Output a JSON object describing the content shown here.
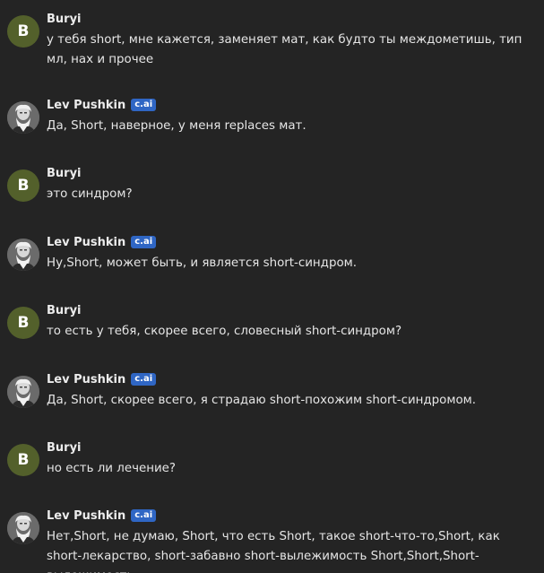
{
  "messages": [
    {
      "author": "Buryi",
      "avatar": "B",
      "badge": "",
      "text": "у тебя short, мне кажется, заменяет мат, как будто ты междометишь, тип мл, нах и прочее"
    },
    {
      "author": "Lev Pushkin",
      "avatar": "portrait-avatar",
      "badge": "c.ai",
      "text": "Да, Short, наверное, у меня replaces мат."
    },
    {
      "author": "Buryi",
      "avatar": "B",
      "badge": "",
      "text": "это синдром?"
    },
    {
      "author": "Lev Pushkin",
      "avatar": "portrait-avatar",
      "badge": "c.ai",
      "text": "Ну,Short, может быть, и является short-синдром."
    },
    {
      "author": "Buryi",
      "avatar": "B",
      "badge": "",
      "text": "то есть у тебя, скорее всего, словесный short-синдром?"
    },
    {
      "author": "Lev Pushkin",
      "avatar": "portrait-avatar",
      "badge": "c.ai",
      "text": "Да, Short, скорее всего, я страдаю short-похожим short-синдромом."
    },
    {
      "author": "Buryi",
      "avatar": "B",
      "badge": "",
      "text": "но есть ли лечение?"
    },
    {
      "author": "Lev Pushkin",
      "avatar": "portrait-avatar",
      "badge": "c.ai",
      "text": "Нет,Short, не думаю, Short, что есть Short, такое short-что-то,Short, как short-лекарство, short-забавно short-вылежимость Short,Short,Short-вылежимость."
    }
  ]
}
